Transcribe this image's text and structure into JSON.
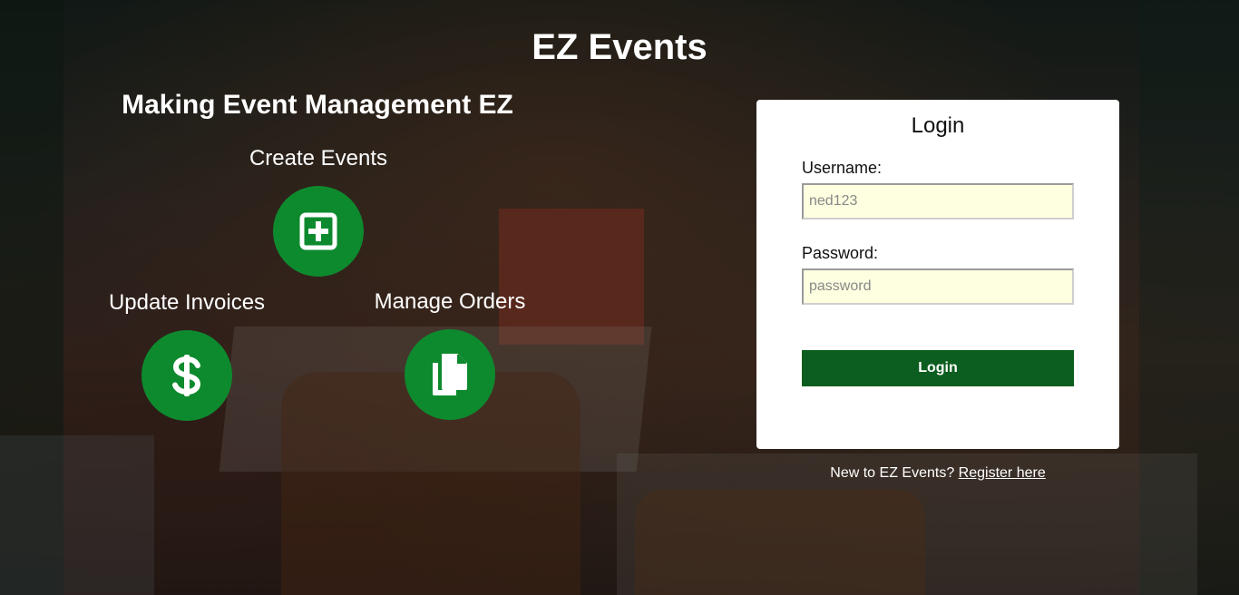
{
  "header": {
    "app_title": "EZ Events",
    "tagline": "Making Event Management EZ"
  },
  "features": {
    "create": {
      "label": "Create Events",
      "icon": "plus-square-icon"
    },
    "invoices": {
      "label": "Update Invoices",
      "icon": "dollar-icon"
    },
    "orders": {
      "label": "Manage Orders",
      "icon": "copy-documents-icon"
    }
  },
  "login": {
    "title": "Login",
    "username_label": "Username:",
    "username_placeholder": "ned123",
    "username_value": "",
    "password_label": "Password:",
    "password_placeholder": "password",
    "password_value": "",
    "button_label": "Login"
  },
  "register": {
    "prompt": "New to EZ Events? ",
    "link_text": "Register here"
  },
  "colors": {
    "feature_circle": "#0e8a2e",
    "login_button": "#0b5e1f",
    "input_background": "#fefee0"
  }
}
